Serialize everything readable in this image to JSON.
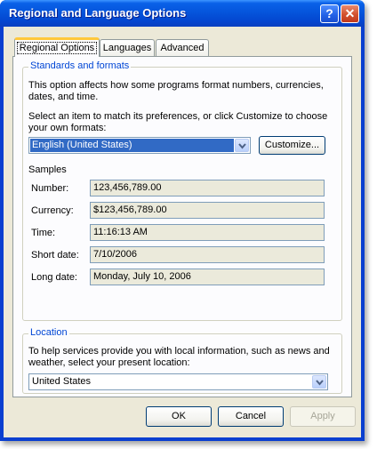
{
  "window": {
    "title": "Regional and Language Options",
    "help_glyph": "?",
    "close_glyph": "✕"
  },
  "tabs": [
    {
      "label": "Regional Options",
      "selected": true
    },
    {
      "label": "Languages",
      "selected": false
    },
    {
      "label": "Advanced",
      "selected": false
    }
  ],
  "standards": {
    "group_label": "Standards and formats",
    "description": "This option affects how some programs format numbers, currencies, dates, and time.",
    "select_prompt": "Select an item to match its preferences, or click Customize to choose your own formats:",
    "selected_format": "English (United States)",
    "customize_label": "Customize...",
    "samples_heading": "Samples",
    "samples": [
      {
        "label": "Number:",
        "value": "123,456,789.00"
      },
      {
        "label": "Currency:",
        "value": "$123,456,789.00"
      },
      {
        "label": "Time:",
        "value": "11:16:13 AM"
      },
      {
        "label": "Short date:",
        "value": "7/10/2006"
      },
      {
        "label": "Long date:",
        "value": "Monday, July 10, 2006"
      }
    ]
  },
  "location": {
    "group_label": "Location",
    "description": "To help services provide you with local information, such as news and weather, select your present location:",
    "selected_location": "United States"
  },
  "footer": {
    "ok_label": "OK",
    "cancel_label": "Cancel",
    "apply_label": "Apply"
  },
  "colors": {
    "titlebar": "#0555dc",
    "group_label": "#0046d5",
    "selection": "#316ac5",
    "tab_highlight": "#ffc83c"
  }
}
